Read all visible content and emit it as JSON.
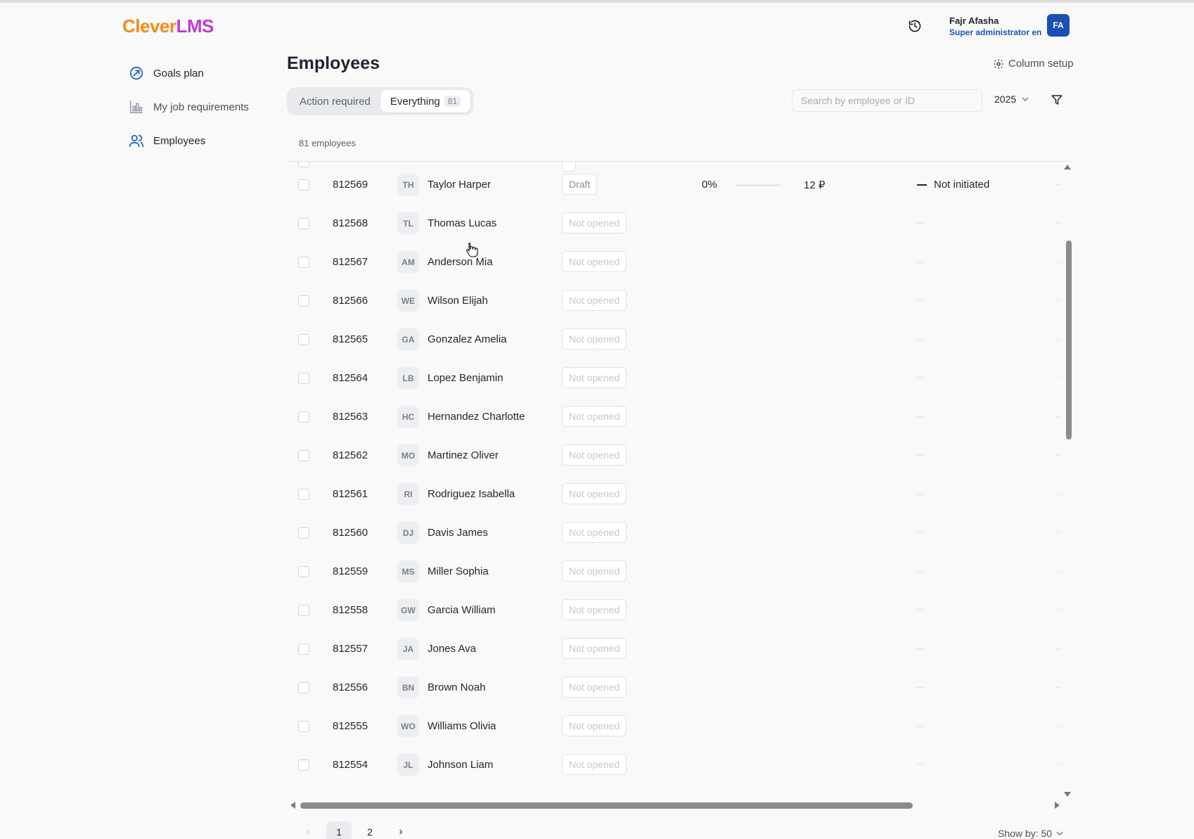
{
  "app": {
    "logo_part1": "Clever",
    "logo_part2": "LMS"
  },
  "user": {
    "name": "Fajr Afasha",
    "role": "Super administrator en",
    "initials": "FA"
  },
  "sidebar": {
    "items": [
      {
        "label": "Goals plan",
        "icon": "target-icon"
      },
      {
        "label": "My job requirements",
        "icon": "chart-icon"
      },
      {
        "label": "Employees",
        "icon": "users-icon"
      }
    ]
  },
  "main": {
    "title": "Employees",
    "column_setup": "Column setup",
    "tabs": [
      {
        "label": "Action required"
      },
      {
        "label": "Everything",
        "count": "81"
      }
    ],
    "search_placeholder": "Search by employee or ID",
    "year": "2025",
    "employee_count": "81 employees"
  },
  "rows": [
    {
      "id": "812569",
      "initials": "TH",
      "name": "Taylor Harper",
      "status": "Draft",
      "progress": "0%",
      "amount": "12 ₽",
      "result": "Not initiated",
      "dash": "—"
    },
    {
      "id": "812568",
      "initials": "TL",
      "name": "Thomas Lucas",
      "status": "Not opened",
      "dash": "--"
    },
    {
      "id": "812567",
      "initials": "AM",
      "name": "Anderson Mia",
      "status": "Not opened",
      "dash": "--"
    },
    {
      "id": "812566",
      "initials": "WE",
      "name": "Wilson Elijah",
      "status": "Not opened",
      "dash": "--"
    },
    {
      "id": "812565",
      "initials": "GA",
      "name": "Gonzalez Amelia",
      "status": "Not opened",
      "dash": "--"
    },
    {
      "id": "812564",
      "initials": "LB",
      "name": "Lopez Benjamin",
      "status": "Not opened",
      "dash": "--"
    },
    {
      "id": "812563",
      "initials": "HC",
      "name": "Hernandez Charlotte",
      "status": "Not opened",
      "dash": "--"
    },
    {
      "id": "812562",
      "initials": "MO",
      "name": "Martinez Oliver",
      "status": "Not opened",
      "dash": "--"
    },
    {
      "id": "812561",
      "initials": "RI",
      "name": "Rodriguez Isabella",
      "status": "Not opened",
      "dash": "--"
    },
    {
      "id": "812560",
      "initials": "DJ",
      "name": "Davis James",
      "status": "Not opened",
      "dash": "--"
    },
    {
      "id": "812559",
      "initials": "MS",
      "name": "Miller Sophia",
      "status": "Not opened",
      "dash": "--"
    },
    {
      "id": "812558",
      "initials": "GW",
      "name": "Garcia William",
      "status": "Not opened",
      "dash": "--"
    },
    {
      "id": "812557",
      "initials": "JA",
      "name": "Jones Ava",
      "status": "Not opened",
      "dash": "--"
    },
    {
      "id": "812556",
      "initials": "BN",
      "name": "Brown Noah",
      "status": "Not opened",
      "dash": "--"
    },
    {
      "id": "812555",
      "initials": "WO",
      "name": "Williams Olivia",
      "status": "Not opened",
      "dash": "--"
    },
    {
      "id": "812554",
      "initials": "JL",
      "name": "Johnson Liam",
      "status": "Not opened",
      "dash": "--"
    }
  ],
  "pagination": {
    "pages": [
      "1",
      "2"
    ],
    "current": "1",
    "prev": "‹",
    "next": "›",
    "show_by": "Show by: 50"
  },
  "colors": {
    "accent": "#1a4fb3",
    "logo_orange": "#f28c1b",
    "logo_magenta": "#c23bd0"
  }
}
